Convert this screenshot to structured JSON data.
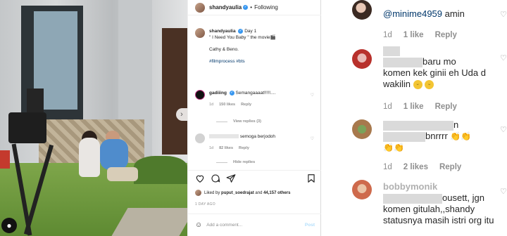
{
  "post": {
    "username": "shandyaulia",
    "follow_status": "Following",
    "caption": {
      "line1": "Day 1",
      "line2": "\" I Need You Baby \" the movie🎬",
      "line3": "Cathy & Beno.",
      "tags": "#filmprocess #bts"
    },
    "comments": [
      {
        "user": "gadiiing",
        "text": "Semangaaaat!!!!!....",
        "time": "1d",
        "likes": "150 likes",
        "reply": "Reply",
        "view_replies": "View replies (3)"
      },
      {
        "user": "",
        "text": "semoga berjodoh",
        "time": "1d",
        "likes": "82 likes",
        "reply": "Reply",
        "view_replies": "Hide replies"
      }
    ],
    "liked_by_prefix": "Liked by",
    "liked_by_user": "puput_soedrajat",
    "liked_by_and": "and",
    "liked_by_count": "44,157 others",
    "time_ago": "1 DAY AGO",
    "add_comment_placeholder": "Add a comment...",
    "post_button": "Post"
  },
  "zoom": {
    "comments": [
      {
        "mention": "@minime4959",
        "text": " amin",
        "time": "1d",
        "likes": "1 like",
        "reply": "Reply"
      },
      {
        "text_tail": "baru mo",
        "text2": "komen kek ginii eh Uda d",
        "text3": "wakilin",
        "time": "1d",
        "likes": "1 like",
        "reply": "Reply"
      },
      {
        "text_tail": "n",
        "text2": "bnrrrr",
        "time": "1d",
        "likes": "2 likes",
        "reply": "Reply"
      },
      {
        "user_partial": "bobbymonik",
        "text_tail": "ousett, jgn",
        "text2": "komen gitulah,,shandy",
        "text3": "statusnya masih istri org itu"
      }
    ]
  }
}
